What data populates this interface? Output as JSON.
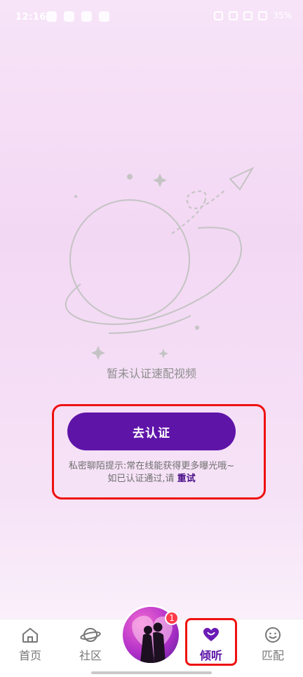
{
  "status_bar": {
    "time": "12:16",
    "battery": "35%",
    "left_icons": [
      "app-notification-icon",
      "app-notification-icon",
      "app-notification-icon",
      "app-notification-icon"
    ],
    "right_icons": [
      "vibrate-icon",
      "nfc-icon",
      "bluetooth-icon",
      "wifi-icon"
    ]
  },
  "empty_state": {
    "illustration": "planet-with-paper-plane",
    "message": "暂未认证速配视频"
  },
  "verify": {
    "button_label": "去认证",
    "tip_line1": "私密聊陌提示:常在线能获得更多曝光哦~",
    "tip_line2_prefix": "如已认证通过,请",
    "retry_label": "重试"
  },
  "tab_bar": {
    "items": [
      {
        "label": "首页",
        "icon": "home-icon"
      },
      {
        "label": "社区",
        "icon": "planet-icon"
      },
      {
        "label": "倾听",
        "icon": "heart-icon",
        "active": true
      },
      {
        "label": "匹配",
        "icon": "smiley-icon"
      }
    ],
    "center_badge": "1"
  },
  "colors": {
    "accent": "#5f14a8",
    "highlight_box": "#e11111",
    "badge": "#ff3b4a"
  }
}
